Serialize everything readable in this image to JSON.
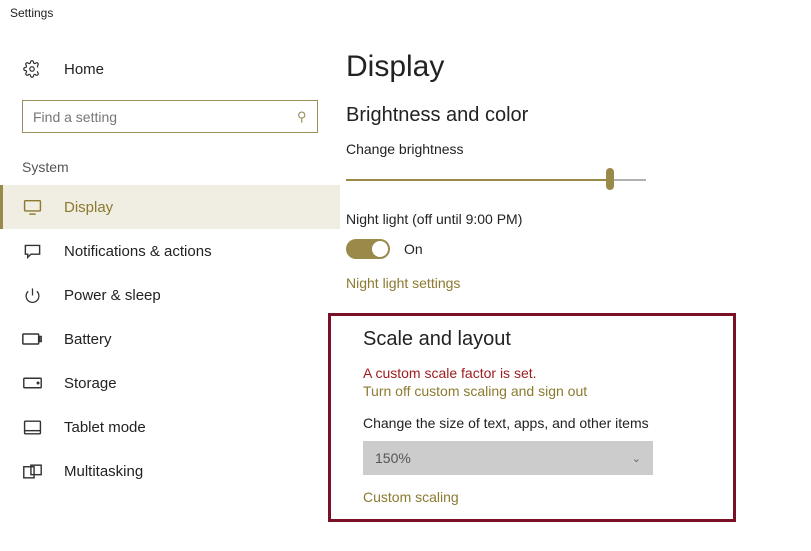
{
  "window": {
    "title": "Settings"
  },
  "sidebar": {
    "home_label": "Home",
    "search_placeholder": "Find a setting",
    "group_label": "System",
    "items": [
      {
        "label": "Display"
      },
      {
        "label": "Notifications & actions"
      },
      {
        "label": "Power & sleep"
      },
      {
        "label": "Battery"
      },
      {
        "label": "Storage"
      },
      {
        "label": "Tablet mode"
      },
      {
        "label": "Multitasking"
      }
    ]
  },
  "main": {
    "heading": "Display",
    "brightness": {
      "heading": "Brightness and color",
      "change_label": "Change brightness",
      "slider_percent": 88,
      "night_light_label": "Night light (off until 9:00 PM)",
      "toggle_state": "On",
      "link_label": "Night light settings"
    },
    "scale": {
      "heading": "Scale and layout",
      "warning": "A custom scale factor is set.",
      "turn_off_link": "Turn off custom scaling and sign out",
      "change_text_label": "Change the size of text, apps, and other items",
      "dropdown_value": "150%",
      "custom_link": "Custom scaling"
    }
  }
}
